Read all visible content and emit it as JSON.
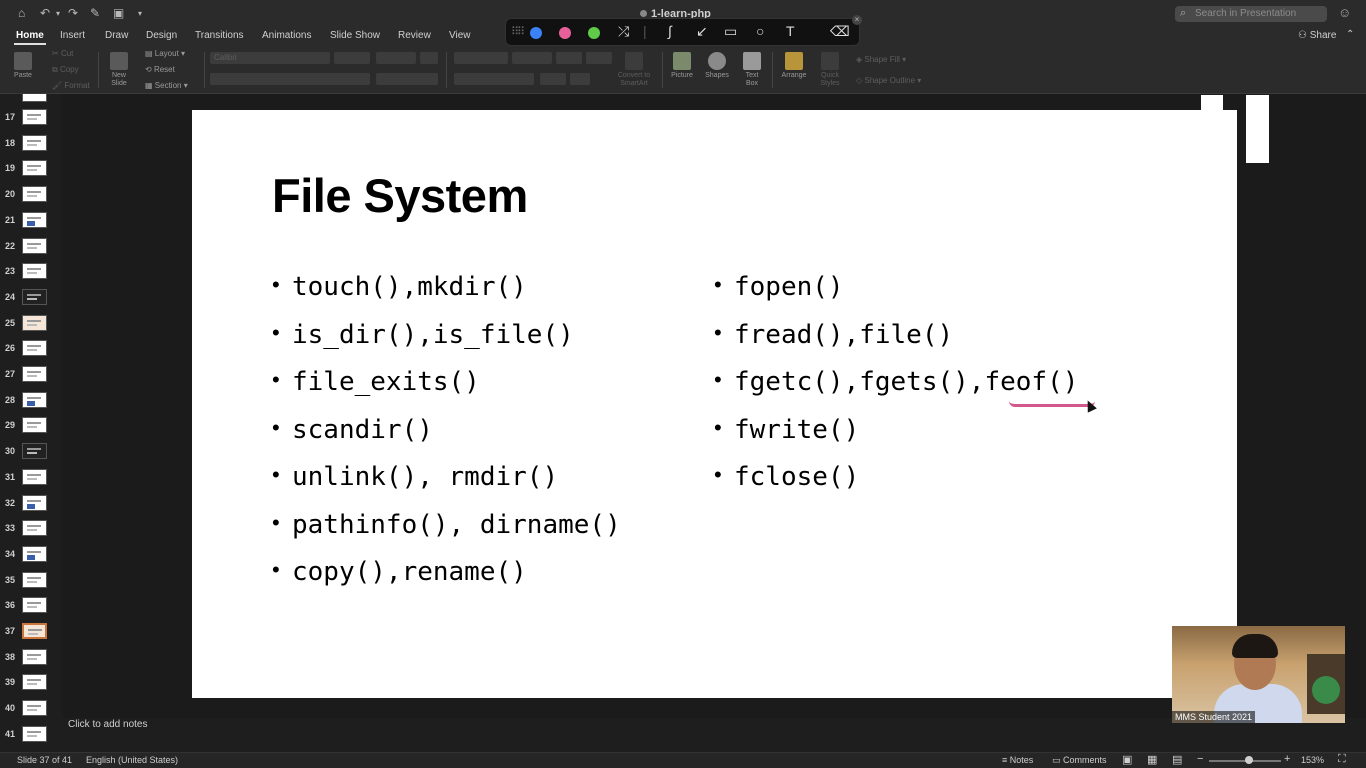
{
  "titlebar": {
    "doc_title": "1-learn-php",
    "search_placeholder": "Search in Presentation"
  },
  "tabs": [
    "Home",
    "Insert",
    "Draw",
    "Design",
    "Transitions",
    "Animations",
    "Slide Show",
    "Review",
    "View"
  ],
  "share_label": "Share",
  "pen_toolbar": {
    "colors": [
      "#3b82f6",
      "#e8609a",
      "#5fc948"
    ]
  },
  "ribbon": {
    "paste": "Paste",
    "cut": "Cut",
    "copy": "Copy",
    "format": "Format",
    "new_slide_1": "New",
    "new_slide_2": "Slide",
    "layout": "Layout",
    "reset": "Reset",
    "section": "Section",
    "font_name": "Calibri",
    "convert_1": "Convert to",
    "convert_2": "SmartArt",
    "picture": "Picture",
    "shapes": "Shapes",
    "textbox_1": "Text",
    "textbox_2": "Box",
    "arrange": "Arrange",
    "quick_styles_1": "Quick",
    "quick_styles_2": "Styles",
    "shape_fill": "Shape Fill",
    "shape_outline": "Shape Outline"
  },
  "thumbnails": [
    {
      "num": "17"
    },
    {
      "num": "18"
    },
    {
      "num": "19"
    },
    {
      "num": "20"
    },
    {
      "num": "21"
    },
    {
      "num": "22"
    },
    {
      "num": "23"
    },
    {
      "num": "24"
    },
    {
      "num": "25"
    },
    {
      "num": "26"
    },
    {
      "num": "27"
    },
    {
      "num": "28"
    },
    {
      "num": "29"
    },
    {
      "num": "30"
    },
    {
      "num": "31"
    },
    {
      "num": "32"
    },
    {
      "num": "33"
    },
    {
      "num": "34"
    },
    {
      "num": "35"
    },
    {
      "num": "36"
    },
    {
      "num": "37"
    },
    {
      "num": "38"
    },
    {
      "num": "39"
    },
    {
      "num": "40"
    },
    {
      "num": "41"
    }
  ],
  "active_slide": "37",
  "slide": {
    "title": "File System",
    "left_bullets": [
      "touch(),mkdir()",
      "is_dir(),is_file()",
      "file_exits()",
      "scandir()",
      "unlink(), rmdir()",
      "pathinfo(), dirname()",
      "copy(),rename()"
    ],
    "right_bullets": [
      "fopen()",
      "fread(),file()",
      "fgetc(),fgets(),feof()",
      "fwrite()",
      "fclose()"
    ]
  },
  "webcam": {
    "name": "MMS Student 2021"
  },
  "notes_placeholder": "Click to add notes",
  "status": {
    "slide_of": "Slide 37 of 41",
    "language": "English (United States)",
    "notes": "Notes",
    "comments": "Comments",
    "zoom": "153%"
  }
}
